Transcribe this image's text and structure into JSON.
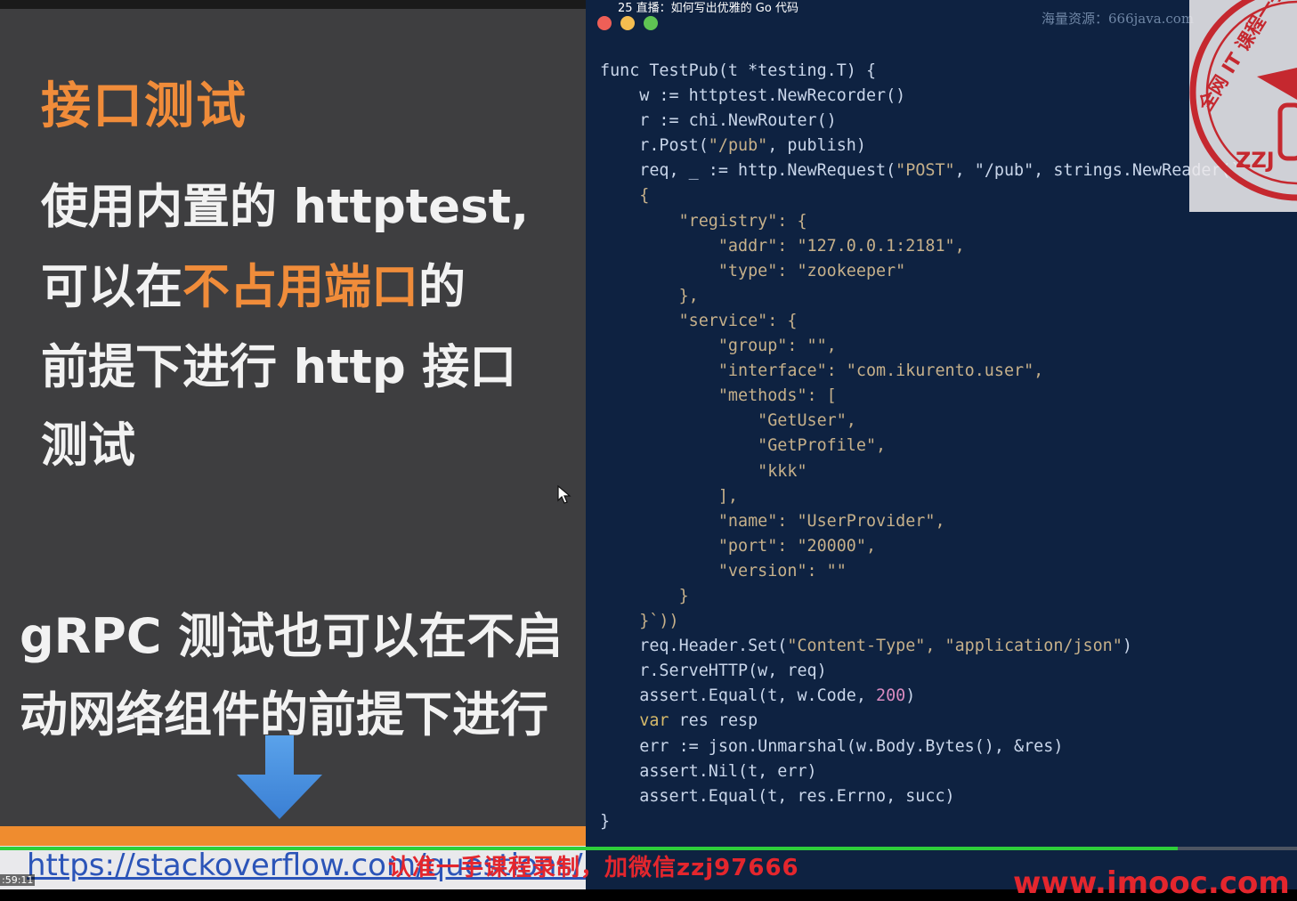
{
  "video": {
    "title": "25 直播：如何写出优雅的 Go 代码",
    "time": ":59:11",
    "progress_fraction": 0.908
  },
  "slide": {
    "title": "接口测试",
    "para1": {
      "line1": "使用内置的 httptest,",
      "line2_pre": "可以在",
      "line2_highlight": "不占用端口",
      "line2_post": "的",
      "line3": "前提下进行 http 接口",
      "line4": "测试"
    },
    "para2": {
      "line1": "gRPC 测试也可以在不启",
      "line2": "动网络组件的前提下进行"
    },
    "url": "https://stackoverflow.com/questions/..."
  },
  "editor": {
    "watermark": "海量资源：666java.com",
    "code": [
      {
        "t": "func TestPub(t *testing.T) {"
      },
      {
        "t": "    w := httptest.NewRecorder()"
      },
      {
        "t": ""
      },
      {
        "t": "    r := chi.NewRouter()"
      },
      {
        "t": "    r.Post(",
        "s": "\"/pub\"",
        "r": ", publish)"
      },
      {
        "t": ""
      },
      {
        "t": "    req, _ := http.NewRequest(",
        "s": "\"POST\"",
        "r": ", \"/pub\", strings.NewReader(`"
      },
      {
        "s": "    {"
      },
      {
        "s": "        \"registry\": {"
      },
      {
        "s": "            \"addr\": \"127.0.0.1:2181\","
      },
      {
        "s": "            \"type\": \"zookeeper\""
      },
      {
        "s": "        },"
      },
      {
        "s": "        \"service\": {"
      },
      {
        "s": "            \"group\": \"\","
      },
      {
        "s": "            \"interface\": \"com.ikurento.user\","
      },
      {
        "s": "            \"methods\": ["
      },
      {
        "s": "                \"GetUser\","
      },
      {
        "s": "                \"GetProfile\","
      },
      {
        "s": "                \"kkk\""
      },
      {
        "s": "            ],"
      },
      {
        "s": "            \"name\": \"UserProvider\","
      },
      {
        "s": "            \"port\": \"20000\","
      },
      {
        "s": "            \"version\": \"\""
      },
      {
        "s": "        }"
      },
      {
        "s": "    }`))"
      },
      {
        "t": "    req.Header.Set(",
        "s": "\"Content-Type\", \"application/json\"",
        "r": ")"
      },
      {
        "t": "    r.ServeHTTP(w, req)"
      },
      {
        "t": "    assert.Equal(t, w.Code, ",
        "n": "200",
        "r": ")"
      },
      {
        "t": ""
      },
      {
        "k": "    var",
        "r": " res resp"
      },
      {
        "t": "    err := json.Unmarshal(w.Body.Bytes(), &res)"
      },
      {
        "t": "    assert.Nil(t, err)"
      },
      {
        "t": "    assert.Equal(t, res.Errno, succ)"
      },
      {
        "t": "}"
      }
    ]
  },
  "stamp": {
    "text": "全网 IT 课程一手",
    "code": "ZZJ"
  },
  "overlay": {
    "red_text": "认准一手课程录制，加微信zzj97666",
    "site_watermark": "www.imooc.com"
  },
  "colors": {
    "slide_bg": "#3e3e40",
    "accent_orange": "#f08c3a",
    "editor_bg": "#0e2241",
    "traffic_red": "#ee5f57",
    "traffic_yellow": "#f4bd50",
    "traffic_green": "#5fc453",
    "progress_green": "#2ecf3a"
  }
}
